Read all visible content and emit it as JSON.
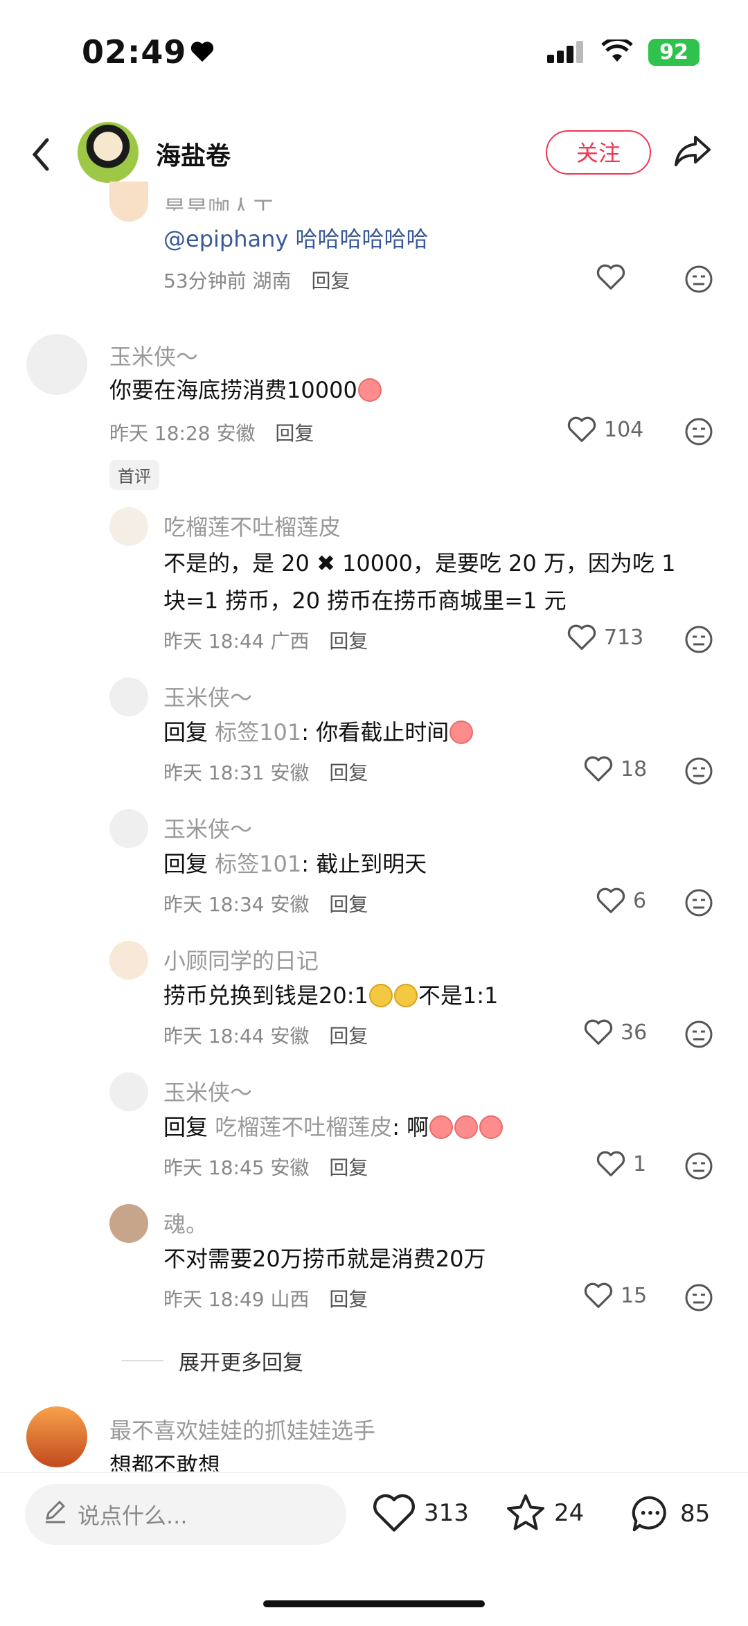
{
  "status_bar": {
    "time": "02:49",
    "battery": "92"
  },
  "header": {
    "title": "海盐卷",
    "follow_label": "关注"
  },
  "comments": [
    {
      "name": "昊昊咖人工",
      "text": "@epiphany 哈哈哈哈哈哈",
      "time": "53分钟前",
      "location": "湖南",
      "reply_label": "回复",
      "likes": ""
    },
    {
      "name": "玉米侠～",
      "text": "你要在海底捞消费10000",
      "time": "昨天 18:28",
      "location": "安徽",
      "reply_label": "回复",
      "likes": "104",
      "badge": "首评"
    },
    {
      "name": "吃榴莲不吐榴莲皮",
      "text_line1": "不是的，是 20 ✖ 10000，是要吃 20 万，因为吃 1",
      "text_line2": "块=1 捞币，20 捞币在捞币商城里=1 元",
      "time": "昨天 18:44",
      "location": "广西",
      "reply_label": "回复",
      "likes": "713"
    },
    {
      "name": "玉米侠～",
      "reply_prefix": "回复",
      "quote": "标签101",
      "text": ": 你看截止时间",
      "time": "昨天 18:31",
      "location": "安徽",
      "reply_label": "回复",
      "likes": "18"
    },
    {
      "name": "玉米侠～",
      "reply_prefix": "回复",
      "quote": "标签101",
      "text": ": 截止到明天",
      "time": "昨天 18:34",
      "location": "安徽",
      "reply_label": "回复",
      "likes": "6"
    },
    {
      "name": "小顾同学的日记",
      "text_a": "捞币兑换到钱是20:1",
      "text_b": "不是1:1",
      "time": "昨天 18:44",
      "location": "安徽",
      "reply_label": "回复",
      "likes": "36"
    },
    {
      "name": "玉米侠～",
      "reply_prefix": "回复",
      "quote": "吃榴莲不吐榴莲皮",
      "text": ": 啊",
      "time": "昨天 18:45",
      "location": "安徽",
      "reply_label": "回复",
      "likes": "1"
    },
    {
      "name": "魂。",
      "text": "不对需要20万捞币就是消费20万",
      "time": "昨天 18:49",
      "location": "山西",
      "reply_label": "回复",
      "likes": "15"
    },
    {
      "name": "最不喜欢娃娃的抓娃娃选手",
      "text": "想都不敢想"
    }
  ],
  "expand_more": "展开更多回复",
  "bottom_bar": {
    "placeholder": "说点什么...",
    "likes": "313",
    "stars": "24",
    "comments": "85"
  }
}
